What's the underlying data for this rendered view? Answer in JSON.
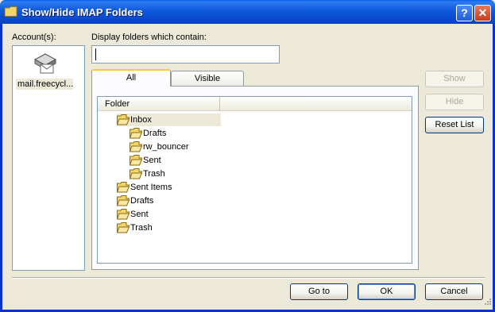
{
  "window": {
    "title": "Show/Hide IMAP Folders"
  },
  "accounts": {
    "label": "Account(s):",
    "items": [
      {
        "name": "mail.freecycl..."
      }
    ]
  },
  "filter": {
    "label": "Display folders which contain:",
    "value": "",
    "placeholder": ""
  },
  "tabs": [
    {
      "label": "All",
      "active": true
    },
    {
      "label": "Visible",
      "active": false
    }
  ],
  "tree": {
    "column_header": "Folder",
    "nodes": [
      {
        "label": "Inbox",
        "level": 0,
        "selected": true
      },
      {
        "label": "Drafts",
        "level": 1
      },
      {
        "label": "rw_bouncer",
        "level": 1
      },
      {
        "label": "Sent",
        "level": 1
      },
      {
        "label": "Trash",
        "level": 1
      },
      {
        "label": "Sent Items",
        "level": 0
      },
      {
        "label": "Drafts",
        "level": 0
      },
      {
        "label": "Sent",
        "level": 0
      },
      {
        "label": "Trash",
        "level": 0
      }
    ]
  },
  "side_buttons": {
    "show": "Show",
    "hide": "Hide",
    "reset": "Reset List"
  },
  "footer_buttons": {
    "goto": "Go to",
    "ok": "OK",
    "cancel": "Cancel"
  },
  "icons": {
    "title": "folder-icon",
    "account": "mail-server-icon",
    "node": "folder-icon"
  },
  "colors": {
    "titlebar": "#0a48cc",
    "tab_highlight": "#ffc83c",
    "selection": "#ece9d8"
  }
}
